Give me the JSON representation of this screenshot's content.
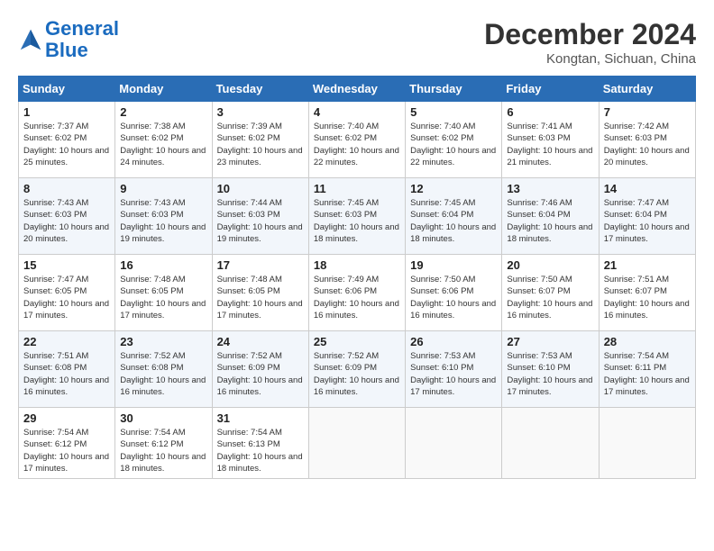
{
  "header": {
    "logo_line1": "General",
    "logo_line2": "Blue",
    "month_title": "December 2024",
    "location": "Kongtan, Sichuan, China"
  },
  "days_of_week": [
    "Sunday",
    "Monday",
    "Tuesday",
    "Wednesday",
    "Thursday",
    "Friday",
    "Saturday"
  ],
  "weeks": [
    [
      {
        "day": "1",
        "sunrise": "7:37 AM",
        "sunset": "6:02 PM",
        "daylight": "10 hours and 25 minutes."
      },
      {
        "day": "2",
        "sunrise": "7:38 AM",
        "sunset": "6:02 PM",
        "daylight": "10 hours and 24 minutes."
      },
      {
        "day": "3",
        "sunrise": "7:39 AM",
        "sunset": "6:02 PM",
        "daylight": "10 hours and 23 minutes."
      },
      {
        "day": "4",
        "sunrise": "7:40 AM",
        "sunset": "6:02 PM",
        "daylight": "10 hours and 22 minutes."
      },
      {
        "day": "5",
        "sunrise": "7:40 AM",
        "sunset": "6:02 PM",
        "daylight": "10 hours and 22 minutes."
      },
      {
        "day": "6",
        "sunrise": "7:41 AM",
        "sunset": "6:03 PM",
        "daylight": "10 hours and 21 minutes."
      },
      {
        "day": "7",
        "sunrise": "7:42 AM",
        "sunset": "6:03 PM",
        "daylight": "10 hours and 20 minutes."
      }
    ],
    [
      {
        "day": "8",
        "sunrise": "7:43 AM",
        "sunset": "6:03 PM",
        "daylight": "10 hours and 20 minutes."
      },
      {
        "day": "9",
        "sunrise": "7:43 AM",
        "sunset": "6:03 PM",
        "daylight": "10 hours and 19 minutes."
      },
      {
        "day": "10",
        "sunrise": "7:44 AM",
        "sunset": "6:03 PM",
        "daylight": "10 hours and 19 minutes."
      },
      {
        "day": "11",
        "sunrise": "7:45 AM",
        "sunset": "6:03 PM",
        "daylight": "10 hours and 18 minutes."
      },
      {
        "day": "12",
        "sunrise": "7:45 AM",
        "sunset": "6:04 PM",
        "daylight": "10 hours and 18 minutes."
      },
      {
        "day": "13",
        "sunrise": "7:46 AM",
        "sunset": "6:04 PM",
        "daylight": "10 hours and 18 minutes."
      },
      {
        "day": "14",
        "sunrise": "7:47 AM",
        "sunset": "6:04 PM",
        "daylight": "10 hours and 17 minutes."
      }
    ],
    [
      {
        "day": "15",
        "sunrise": "7:47 AM",
        "sunset": "6:05 PM",
        "daylight": "10 hours and 17 minutes."
      },
      {
        "day": "16",
        "sunrise": "7:48 AM",
        "sunset": "6:05 PM",
        "daylight": "10 hours and 17 minutes."
      },
      {
        "day": "17",
        "sunrise": "7:48 AM",
        "sunset": "6:05 PM",
        "daylight": "10 hours and 17 minutes."
      },
      {
        "day": "18",
        "sunrise": "7:49 AM",
        "sunset": "6:06 PM",
        "daylight": "10 hours and 16 minutes."
      },
      {
        "day": "19",
        "sunrise": "7:50 AM",
        "sunset": "6:06 PM",
        "daylight": "10 hours and 16 minutes."
      },
      {
        "day": "20",
        "sunrise": "7:50 AM",
        "sunset": "6:07 PM",
        "daylight": "10 hours and 16 minutes."
      },
      {
        "day": "21",
        "sunrise": "7:51 AM",
        "sunset": "6:07 PM",
        "daylight": "10 hours and 16 minutes."
      }
    ],
    [
      {
        "day": "22",
        "sunrise": "7:51 AM",
        "sunset": "6:08 PM",
        "daylight": "10 hours and 16 minutes."
      },
      {
        "day": "23",
        "sunrise": "7:52 AM",
        "sunset": "6:08 PM",
        "daylight": "10 hours and 16 minutes."
      },
      {
        "day": "24",
        "sunrise": "7:52 AM",
        "sunset": "6:09 PM",
        "daylight": "10 hours and 16 minutes."
      },
      {
        "day": "25",
        "sunrise": "7:52 AM",
        "sunset": "6:09 PM",
        "daylight": "10 hours and 16 minutes."
      },
      {
        "day": "26",
        "sunrise": "7:53 AM",
        "sunset": "6:10 PM",
        "daylight": "10 hours and 17 minutes."
      },
      {
        "day": "27",
        "sunrise": "7:53 AM",
        "sunset": "6:10 PM",
        "daylight": "10 hours and 17 minutes."
      },
      {
        "day": "28",
        "sunrise": "7:54 AM",
        "sunset": "6:11 PM",
        "daylight": "10 hours and 17 minutes."
      }
    ],
    [
      {
        "day": "29",
        "sunrise": "7:54 AM",
        "sunset": "6:12 PM",
        "daylight": "10 hours and 17 minutes."
      },
      {
        "day": "30",
        "sunrise": "7:54 AM",
        "sunset": "6:12 PM",
        "daylight": "10 hours and 18 minutes."
      },
      {
        "day": "31",
        "sunrise": "7:54 AM",
        "sunset": "6:13 PM",
        "daylight": "10 hours and 18 minutes."
      },
      null,
      null,
      null,
      null
    ]
  ]
}
